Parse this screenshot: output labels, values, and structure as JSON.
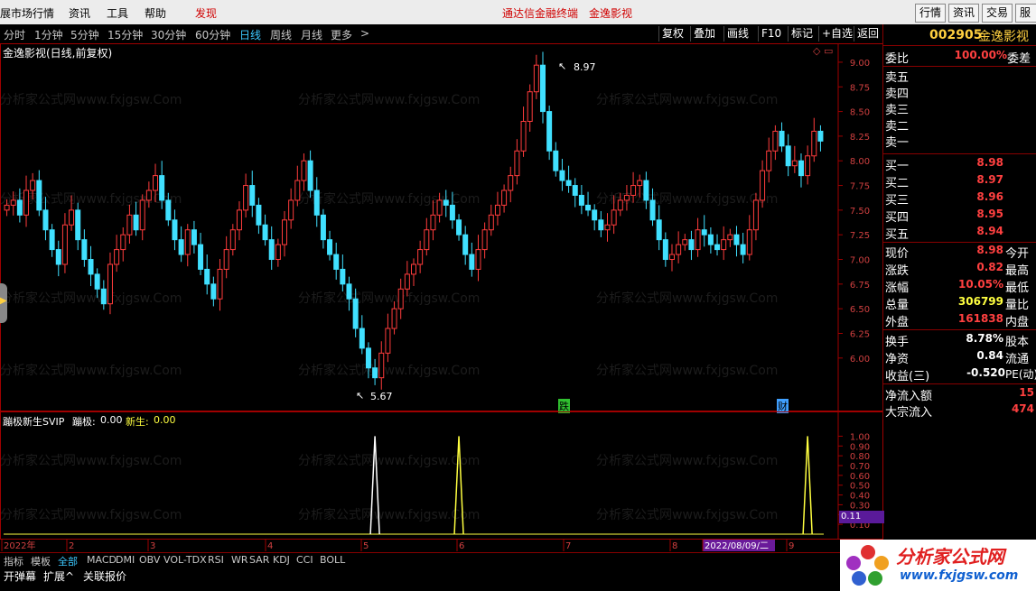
{
  "menubar": {
    "items": [
      "展市场行情",
      "资讯",
      "工具",
      "帮助"
    ],
    "discover": "发现",
    "center_title": "通达信金融终端",
    "center_stock": "金逸影视",
    "right_buttons": [
      "行情",
      "资讯",
      "交易",
      "服务"
    ]
  },
  "toolbar": {
    "periods": [
      "分时",
      "1分钟",
      "5分钟",
      "15分钟",
      "30分钟",
      "60分钟",
      "日线",
      "周线",
      "月线",
      "更多"
    ],
    "more_arrow": ">",
    "active": "日线",
    "tools": [
      "复权",
      "叠加",
      "画线",
      "F10",
      "标记",
      "+自选",
      "返回"
    ]
  },
  "main_chart": {
    "title": "金逸影视(日线,前复权)",
    "high_label": "8.97",
    "low_label": "5.67",
    "event_labels": [
      "跌",
      "财"
    ],
    "watermark": "分析家公式网www.fxjgsw.Com"
  },
  "chart_data": [
    {
      "type": "candlestick",
      "title": "金逸影视(日线,前复权)",
      "ylim": [
        5.55,
        9.1
      ],
      "yticks": [
        6.0,
        6.25,
        6.5,
        6.75,
        7.0,
        7.25,
        7.5,
        7.75,
        8.0,
        8.25,
        8.5,
        8.75,
        9.0
      ],
      "x_month_labels": [
        "2022年",
        "2",
        "3",
        "4",
        "5",
        "6",
        "7",
        "8",
        "2022/08/09/二",
        "9"
      ],
      "annotations": [
        {
          "text": "8.97",
          "value": 8.97
        },
        {
          "text": "5.67",
          "value": 5.67
        }
      ],
      "closes": [
        7.55,
        7.6,
        7.45,
        7.7,
        7.8,
        7.5,
        7.3,
        7.1,
        6.95,
        7.35,
        7.5,
        7.2,
        7.0,
        6.85,
        6.7,
        6.55,
        6.95,
        7.1,
        7.25,
        7.45,
        7.3,
        7.6,
        7.7,
        7.85,
        7.6,
        7.4,
        7.2,
        7.05,
        7.3,
        7.15,
        6.9,
        6.75,
        6.6,
        6.9,
        7.1,
        7.3,
        7.5,
        7.75,
        7.55,
        7.35,
        7.2,
        7.0,
        7.15,
        7.4,
        7.6,
        7.8,
        8.0,
        7.7,
        7.45,
        7.2,
        7.05,
        6.9,
        6.75,
        6.6,
        6.3,
        6.1,
        5.9,
        5.8,
        6.05,
        6.3,
        6.5,
        6.7,
        6.85,
        6.95,
        7.1,
        7.3,
        7.45,
        7.6,
        7.55,
        7.4,
        7.25,
        7.05,
        6.9,
        7.1,
        7.3,
        7.45,
        7.55,
        7.7,
        7.85,
        8.1,
        8.4,
        8.7,
        8.97,
        8.5,
        8.1,
        7.9,
        7.8,
        7.75,
        7.65,
        7.55,
        7.5,
        7.4,
        7.3,
        7.35,
        7.5,
        7.6,
        7.65,
        7.75,
        7.8,
        7.6,
        7.4,
        7.2,
        7.0,
        7.05,
        7.15,
        7.2,
        7.1,
        7.3,
        7.25,
        7.15,
        7.1,
        7.2,
        7.25,
        7.15,
        7.05,
        7.3,
        7.6,
        7.9,
        8.1,
        8.3,
        8.15,
        7.95,
        8.0,
        7.85,
        8.05,
        8.3,
        8.2
      ],
      "series": [
        {
          "name": "蹦极新生SVIP"
        }
      ]
    },
    {
      "type": "line",
      "title": "蹦极新生SVIP",
      "legend": [
        {
          "name": "蹦极",
          "value": "0.00"
        },
        {
          "name": "新生",
          "value": "0.00"
        }
      ],
      "ylim": [
        0,
        1.05
      ],
      "yticks": [
        0.1,
        0.2,
        0.3,
        0.4,
        0.5,
        0.6,
        0.7,
        0.8,
        0.9,
        1.0
      ],
      "current_value": "0.11",
      "spikes": [
        {
          "series": "蹦极",
          "x_index": 57,
          "value": 1.0
        },
        {
          "series": "新生",
          "x_index": 70,
          "value": 1.0
        },
        {
          "series": "新生",
          "x_index": 124,
          "value": 1.0
        }
      ]
    }
  ],
  "indicator": {
    "title": "蹦极新生SVIP",
    "l1_name": "蹦极:",
    "l1_val": "0.00",
    "l2_name": "新生:",
    "l2_val": "0.00",
    "current": "0.11"
  },
  "quote": {
    "code": "002905",
    "name": "金逸影视",
    "webi_label": "委比",
    "webi_value": "100.00%",
    "weicha_label": "委差",
    "sells": [
      "卖五",
      "卖四",
      "卖三",
      "卖二",
      "卖一"
    ],
    "buys": [
      {
        "label": "买一",
        "price": "8.98"
      },
      {
        "label": "买二",
        "price": "8.97"
      },
      {
        "label": "买三",
        "price": "8.96"
      },
      {
        "label": "买四",
        "price": "8.95"
      },
      {
        "label": "买五",
        "price": "8.94"
      }
    ],
    "stats": [
      {
        "label": "现价",
        "value": "8.98",
        "right": "今开",
        "color": "#ff4040"
      },
      {
        "label": "涨跌",
        "value": "0.82",
        "right": "最高",
        "color": "#ff4040"
      },
      {
        "label": "涨幅",
        "value": "10.05%",
        "right": "最低",
        "color": "#ff4040"
      },
      {
        "label": "总量",
        "value": "306799",
        "right": "量比",
        "color": "#ffff40"
      },
      {
        "label": "外盘",
        "value": "161838",
        "right": "内盘",
        "color": "#ff4040"
      }
    ],
    "stats2": [
      {
        "label": "换手",
        "value": "8.78%",
        "right": "股本",
        "color": "#ffffff"
      },
      {
        "label": "净资",
        "value": "0.84",
        "right": "流通",
        "color": "#ffffff"
      },
      {
        "label": "收益(三)",
        "value": "-0.520",
        "right": "PE(动)",
        "color": "#ffffff"
      }
    ],
    "flows": [
      {
        "label": "净流入额",
        "value": "15"
      },
      {
        "label": "大宗流入",
        "value": "474"
      }
    ]
  },
  "tabs": {
    "items": [
      "指标",
      "模板",
      "全部",
      "MACD",
      "DMI",
      "OBV",
      "VOL-TDX",
      "RSI",
      "WR",
      "SAR",
      "KDJ",
      "CCI",
      "BOLL"
    ],
    "active": "全部"
  },
  "bottom": {
    "items": [
      "开弹幕",
      "扩展^",
      "关联报价"
    ]
  },
  "logo": {
    "name": "分析家公式网",
    "url": "www.fxjgsw.com"
  }
}
